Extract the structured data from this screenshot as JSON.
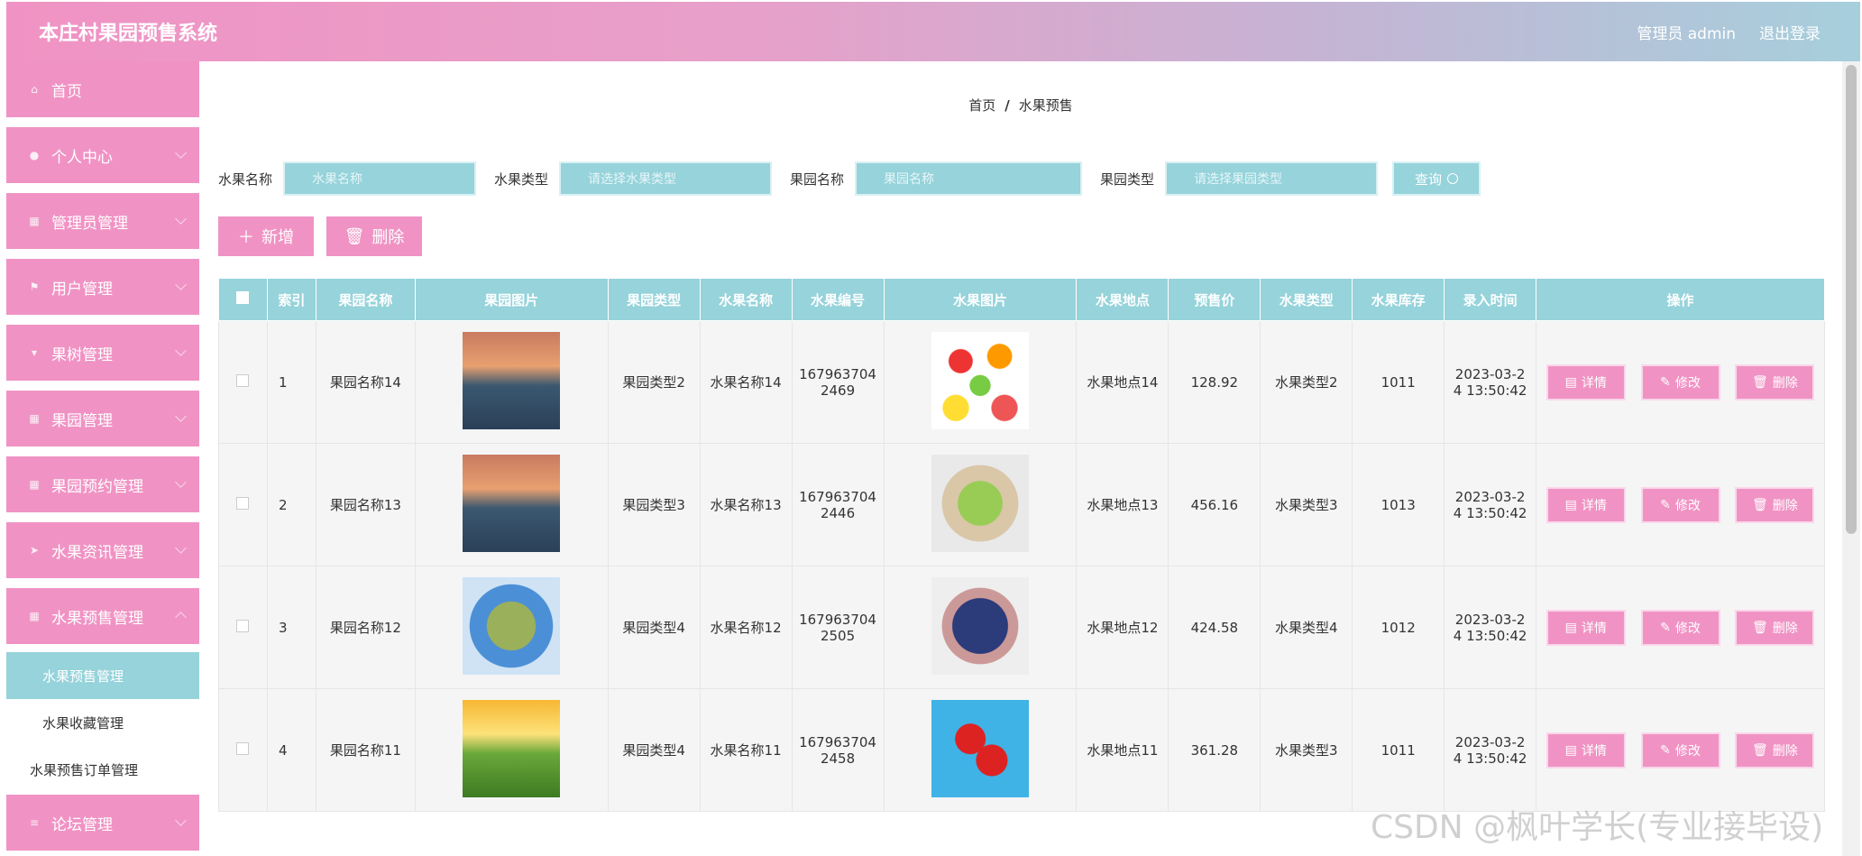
{
  "app": {
    "title": "本庄村果园预售系统"
  },
  "header": {
    "user_label": "管理员 admin",
    "logout_label": "退出登录"
  },
  "sidebar": {
    "items": [
      {
        "label": "首页"
      },
      {
        "label": "个人中心"
      },
      {
        "label": "管理员管理"
      },
      {
        "label": "用户管理"
      },
      {
        "label": "果树管理"
      },
      {
        "label": "果园管理"
      },
      {
        "label": "果园预约管理"
      },
      {
        "label": "水果资讯管理"
      },
      {
        "label": "水果预售管理"
      },
      {
        "label": "水果预售管理"
      },
      {
        "label": "水果收藏管理"
      },
      {
        "label": "水果预售订单管理"
      },
      {
        "label": "论坛管理"
      }
    ]
  },
  "breadcrumb": {
    "home": "首页",
    "sep": "/",
    "current": "水果预售"
  },
  "search": {
    "f1_label": "水果名称",
    "f1_placeholder": "水果名称",
    "f2_label": "水果类型",
    "f2_placeholder": "请选择水果类型",
    "f3_label": "果园名称",
    "f3_placeholder": "果园名称",
    "f4_label": "果园类型",
    "f4_placeholder": "请选择果园类型",
    "query_label": "查询"
  },
  "actions": {
    "add_label": "新增",
    "delete_label": "删除"
  },
  "table": {
    "headers": [
      "",
      "索引",
      "果园名称",
      "果园图片",
      "果园类型",
      "水果名称",
      "水果编号",
      "水果图片",
      "水果地点",
      "预售价",
      "水果类型",
      "水果库存",
      "录入时间",
      "操作"
    ],
    "rows": [
      {
        "idx": "1",
        "orchard": "果园名称14",
        "otype": "果园类型2",
        "fruit": "水果名称14",
        "code1": "167963704",
        "code2": "2469",
        "place": "水果地点14",
        "price": "128.92",
        "ftype": "水果类型2",
        "stock": "1011",
        "time1": "2023-03-2",
        "time2": "4 13:50:42"
      },
      {
        "idx": "2",
        "orchard": "果园名称13",
        "otype": "果园类型3",
        "fruit": "水果名称13",
        "code1": "167963704",
        "code2": "2446",
        "place": "水果地点13",
        "price": "456.16",
        "ftype": "水果类型3",
        "stock": "1013",
        "time1": "2023-03-2",
        "time2": "4 13:50:42"
      },
      {
        "idx": "3",
        "orchard": "果园名称12",
        "otype": "果园类型4",
        "fruit": "水果名称12",
        "code1": "167963704",
        "code2": "2505",
        "place": "水果地点12",
        "price": "424.58",
        "ftype": "水果类型4",
        "stock": "1012",
        "time1": "2023-03-2",
        "time2": "4 13:50:42"
      },
      {
        "idx": "4",
        "orchard": "果园名称11",
        "otype": "果园类型4",
        "fruit": "水果名称11",
        "code1": "167963704",
        "code2": "2458",
        "place": "水果地点11",
        "price": "361.28",
        "ftype": "水果类型3",
        "stock": "1011",
        "time1": "2023-03-2",
        "time2": "4 13:50:42"
      }
    ],
    "ops": {
      "detail": "详情",
      "edit": "修改",
      "delete": "删除"
    }
  },
  "watermark": "CSDN @枫叶学长(专业接毕设)",
  "colors": {
    "accent_pink": "#f093c4",
    "accent_teal": "#96d3db"
  }
}
